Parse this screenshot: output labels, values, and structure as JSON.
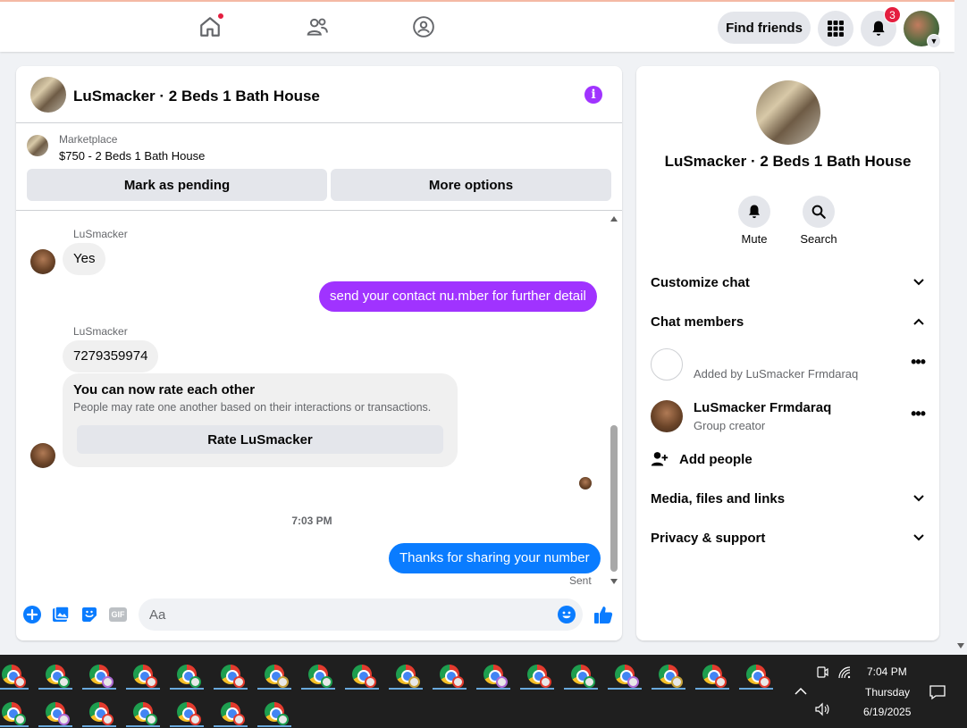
{
  "topbar": {
    "find_friends": "Find friends",
    "notification_count": "3",
    "icons": [
      "home-icon",
      "friends-icon",
      "groups-icon",
      "menu-grid-icon",
      "bell-icon"
    ]
  },
  "chat": {
    "title": "LuSmacker · 2 Beds 1 Bath House",
    "marketplace_label": "Marketplace",
    "listing": "$750 - 2 Beds 1 Bath House",
    "mark_pending": "Mark as pending",
    "more_options": "More options",
    "messages": {
      "sender1": "LuSmacker",
      "msg1": "Yes",
      "msg2": "send your contact nu.mber for further detail",
      "sender2": "LuSmacker",
      "msg3": "7279359974",
      "rate_title": "You can now rate each other",
      "rate_sub": "People may rate one another based on their interactions or transactions.",
      "rate_button": "Rate LuSmacker",
      "time": "7:03 PM",
      "msg4": "Thanks for sharing your number",
      "status": "Sent"
    },
    "composer_placeholder": "Aa",
    "gif_label": "GIF"
  },
  "side": {
    "title": "LuSmacker · 2 Beds 1 Bath House",
    "mute": "Mute",
    "search": "Search",
    "customize": "Customize chat",
    "chat_members": "Chat members",
    "member1_sub": "Added by LuSmacker Frmdaraq",
    "member2_name": "LuSmacker Frmdaraq",
    "member2_sub": "Group creator",
    "add_people": "Add people",
    "media": "Media, files and links",
    "privacy": "Privacy & support"
  },
  "taskbar": {
    "time": "7:04 PM",
    "day": "Thursday",
    "date": "6/19/2025"
  },
  "colors": {
    "purple": "#a033ff",
    "blue": "#0a7cff",
    "badge_red": "#e41e3f"
  }
}
